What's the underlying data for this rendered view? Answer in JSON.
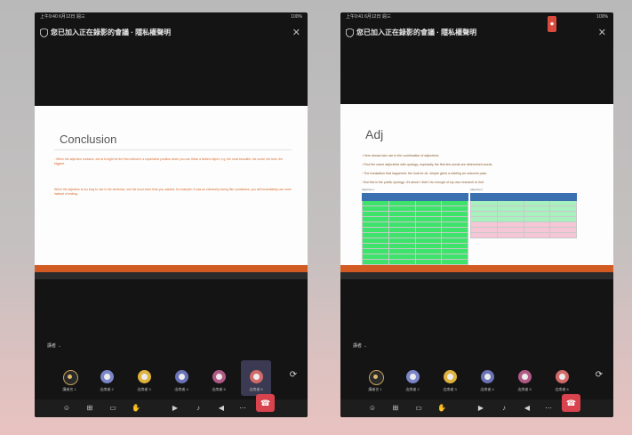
{
  "left": {
    "status_left": "上午9:40 6月12日 週三",
    "status_right": "100%",
    "meeting_title": "您已加入正在錄影的會議 · 隱私權聲明",
    "close_glyph": "✕",
    "slide": {
      "title": "Conclusion",
      "para1": "When the adjective contains -est at it might be the first ordinal in a superlative position when you use these a limited object, e.g. the most beautiful, the worst, the best, the biggest.",
      "para2": "When the adjective is too long to use in the sentence, use the most more than you wanted, for example: it was an extremely boring film sometimes, you will immediately use more instead of ending."
    },
    "speaker_tag": "講者",
    "speaker_chev": "⌄",
    "participants": [
      {
        "name": "講者名 1",
        "color": "#2a2a2a"
      },
      {
        "name": "出席者 2",
        "color": "#7a86c9"
      },
      {
        "name": "出席者 3",
        "color": "#e0b23e"
      },
      {
        "name": "出席者 4",
        "color": "#6b73b8"
      },
      {
        "name": "出席者 5",
        "color": "#b25a86"
      },
      {
        "name": "出席者 6",
        "color": "#d36a6a"
      }
    ],
    "expand_glyph": "⟳",
    "controls": [
      "☺",
      "⊞",
      "▭",
      "✋",
      "▶",
      "♪",
      "◀",
      "⋯"
    ],
    "hangup_glyph": "☎"
  },
  "right": {
    "status_left": "上午9:41 6月12日 週三",
    "status_right": "100%",
    "meeting_title": "您已加入正在錄影的會議 · 隱私權聲明",
    "rec_glyph": "●",
    "close_glyph": "✕",
    "slide": {
      "title": "Adj",
      "bullets": [
        "Here ahead size use in the combination of adjectives",
        "Find the name adjectives with opology, especially the first few words are determined words",
        "The translation that happened: the look be ok. simple gives a starting an outcome pass",
        "But this is the public opology: It's about I didn't do enough of my own research to find"
      ],
      "highlight": "public opology",
      "table1_caption": "Adjectives 1",
      "table2_caption": "Adjectives 2"
    },
    "speaker_tag": "講者",
    "speaker_chev": "⌄",
    "participants": [
      {
        "name": "講者名 1",
        "color": "#2a2a2a"
      },
      {
        "name": "出席者 2",
        "color": "#7a86c9"
      },
      {
        "name": "出席者 3",
        "color": "#e0b23e"
      },
      {
        "name": "出席者 4",
        "color": "#6b73b8"
      },
      {
        "name": "出席者 5",
        "color": "#b25a86"
      },
      {
        "name": "出席者 6",
        "color": "#d36a6a"
      }
    ],
    "expand_glyph": "⟳",
    "controls": [
      "☺",
      "⊞",
      "▭",
      "✋",
      "▶",
      "♪",
      "◀",
      "⋯"
    ],
    "hangup_glyph": "☎"
  },
  "colors": {
    "accent_orange": "#d25a23",
    "hangup_red": "#d8434e",
    "table_green": "#3ee36c"
  }
}
